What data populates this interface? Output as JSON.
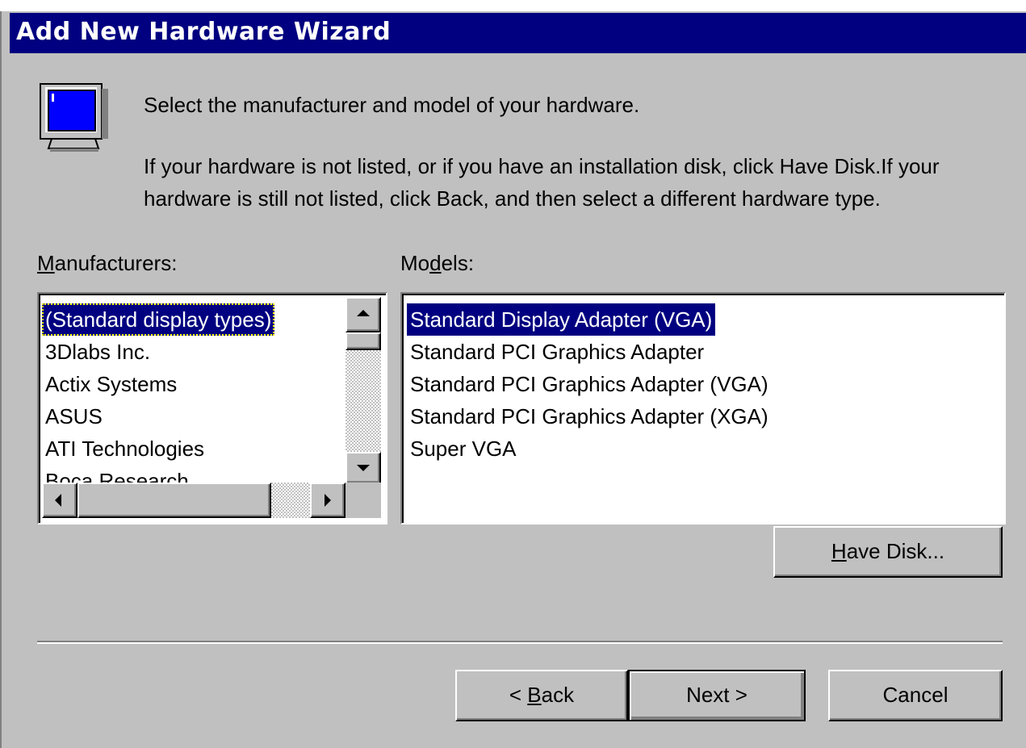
{
  "window": {
    "title": "Add New Hardware Wizard"
  },
  "header": {
    "heading": "Select the manufacturer and model of your hardware.",
    "instructions": "If your hardware is not listed, or if you have an installation disk, click Have Disk.If your hardware is still not listed, click Back, and then select a different hardware type."
  },
  "manufacturers": {
    "label_mnemonic": "M",
    "label_rest": "anufacturers:",
    "items": [
      "(Standard display types)",
      "3Dlabs Inc.",
      "Actix Systems",
      "ASUS",
      "ATI Technologies",
      "Boca Research"
    ],
    "selected": "(Standard display types)"
  },
  "models": {
    "label_pre": "Mo",
    "label_mnemonic": "d",
    "label_post": "els:",
    "items": [
      "Standard Display Adapter (VGA)",
      "Standard PCI Graphics Adapter",
      "Standard PCI Graphics Adapter (VGA)",
      "Standard PCI Graphics Adapter (XGA)",
      "Super VGA"
    ],
    "selected": "Standard Display Adapter (VGA)"
  },
  "buttons": {
    "have_disk_mnemonic": "H",
    "have_disk_rest": "ave Disk...",
    "back_pre": "< ",
    "back_mnemonic": "B",
    "back_rest": "ack",
    "next": "Next >",
    "cancel": "Cancel"
  },
  "icons": {
    "monitor": "monitor-icon",
    "scroll_up": "arrow-up-icon",
    "scroll_down": "arrow-down-icon",
    "scroll_left": "arrow-left-icon",
    "scroll_right": "arrow-right-icon"
  },
  "colors": {
    "titlebar": "#000080",
    "selection": "#000080",
    "face": "#c0c0c0"
  }
}
